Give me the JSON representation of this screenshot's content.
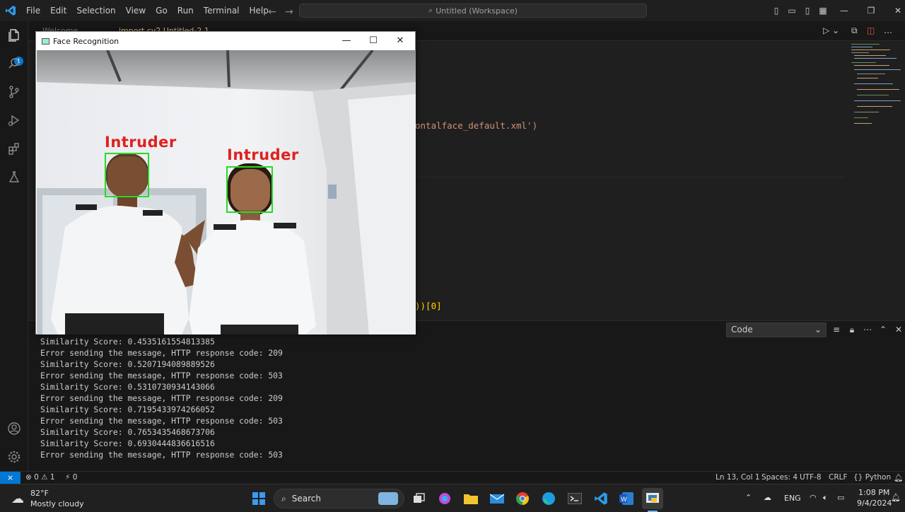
{
  "menu": [
    "File",
    "Edit",
    "Selection",
    "View",
    "Go",
    "Run",
    "Terminal",
    "Help"
  ],
  "command_center": "Untitled (Workspace)",
  "activity_badge": "1",
  "tabs": [
    "Welcome",
    "import cv2  Untitled-2.1"
  ],
  "editor": {
    "line_a": "ontalface_default.xml')",
    "line_b": "))[0]"
  },
  "face_window": {
    "title": "Face Recognition",
    "labels": [
      "Intruder",
      "Intruder"
    ]
  },
  "panel": {
    "select_value": "Code",
    "output": [
      "Similarity Score: 0.4535161554813385",
      "Error sending the message, HTTP response code: 209",
      "Similarity Score: 0.5207194089889526",
      "Error sending the message, HTTP response code: 503",
      "Similarity Score: 0.5310730934143066",
      "Error sending the message, HTTP response code: 209",
      "Similarity Score: 0.7195433974266052",
      "Error sending the message, HTTP response code: 503",
      "Similarity Score: 0.7653435468673706",
      "Similarity Score: 0.6930444836616516",
      "Error sending the message, HTTP response code: 503"
    ]
  },
  "statusbar": {
    "problems": "⊗ 0 ⚠ 1",
    "ports": "⚡ 0",
    "position": "Ln 13, Col 1",
    "spaces": "Spaces: 4",
    "encoding": "UTF-8",
    "eol": "CRLF",
    "language": "{} Python"
  },
  "taskbar": {
    "weather_temp": "82°F",
    "weather_desc": "Mostly cloudy",
    "search": "Search",
    "lang": "ENG",
    "time": "1:08 PM",
    "date": "9/4/2024"
  },
  "colors": {
    "accent": "#0078d4",
    "intruder_text": "#e02020",
    "face_box": "#22dd22"
  }
}
